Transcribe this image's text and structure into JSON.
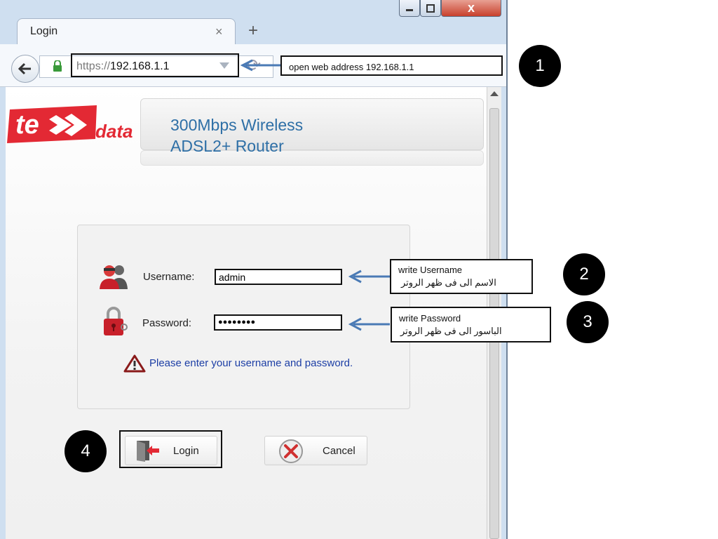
{
  "browser": {
    "tab_title": "Login",
    "tab_close": "×",
    "new_tab": "+",
    "url_prefix": "https://",
    "url_host": "192.168.1.1",
    "window_close": "x"
  },
  "router_page": {
    "brand_data": "data",
    "product_line1": "300Mbps Wireless",
    "product_line2": "ADSL2+ Router",
    "username_label": "Username:",
    "username_value": "admin",
    "password_label": "Password:",
    "password_value": "●●●●●●●●",
    "message": "Please enter your username and password.",
    "login_button": "Login",
    "cancel_button": "Cancel"
  },
  "annotations": {
    "step1_text": "open web address  192.168.1.1",
    "step2_text_en": "write Username",
    "step2_text_ar": "الاسم الى فى ظهر الروتر",
    "step3_text_en": "write  Password",
    "step3_text_ar": "الباسور الى فى ظهر الروتر",
    "step_numbers": [
      "1",
      "2",
      "3",
      "4"
    ]
  },
  "colors": {
    "brand_red": "#e32934",
    "product_blue": "#2e6fa6",
    "message_blue": "#1c3ea5",
    "arrow_blue": "#4a7ab5"
  }
}
